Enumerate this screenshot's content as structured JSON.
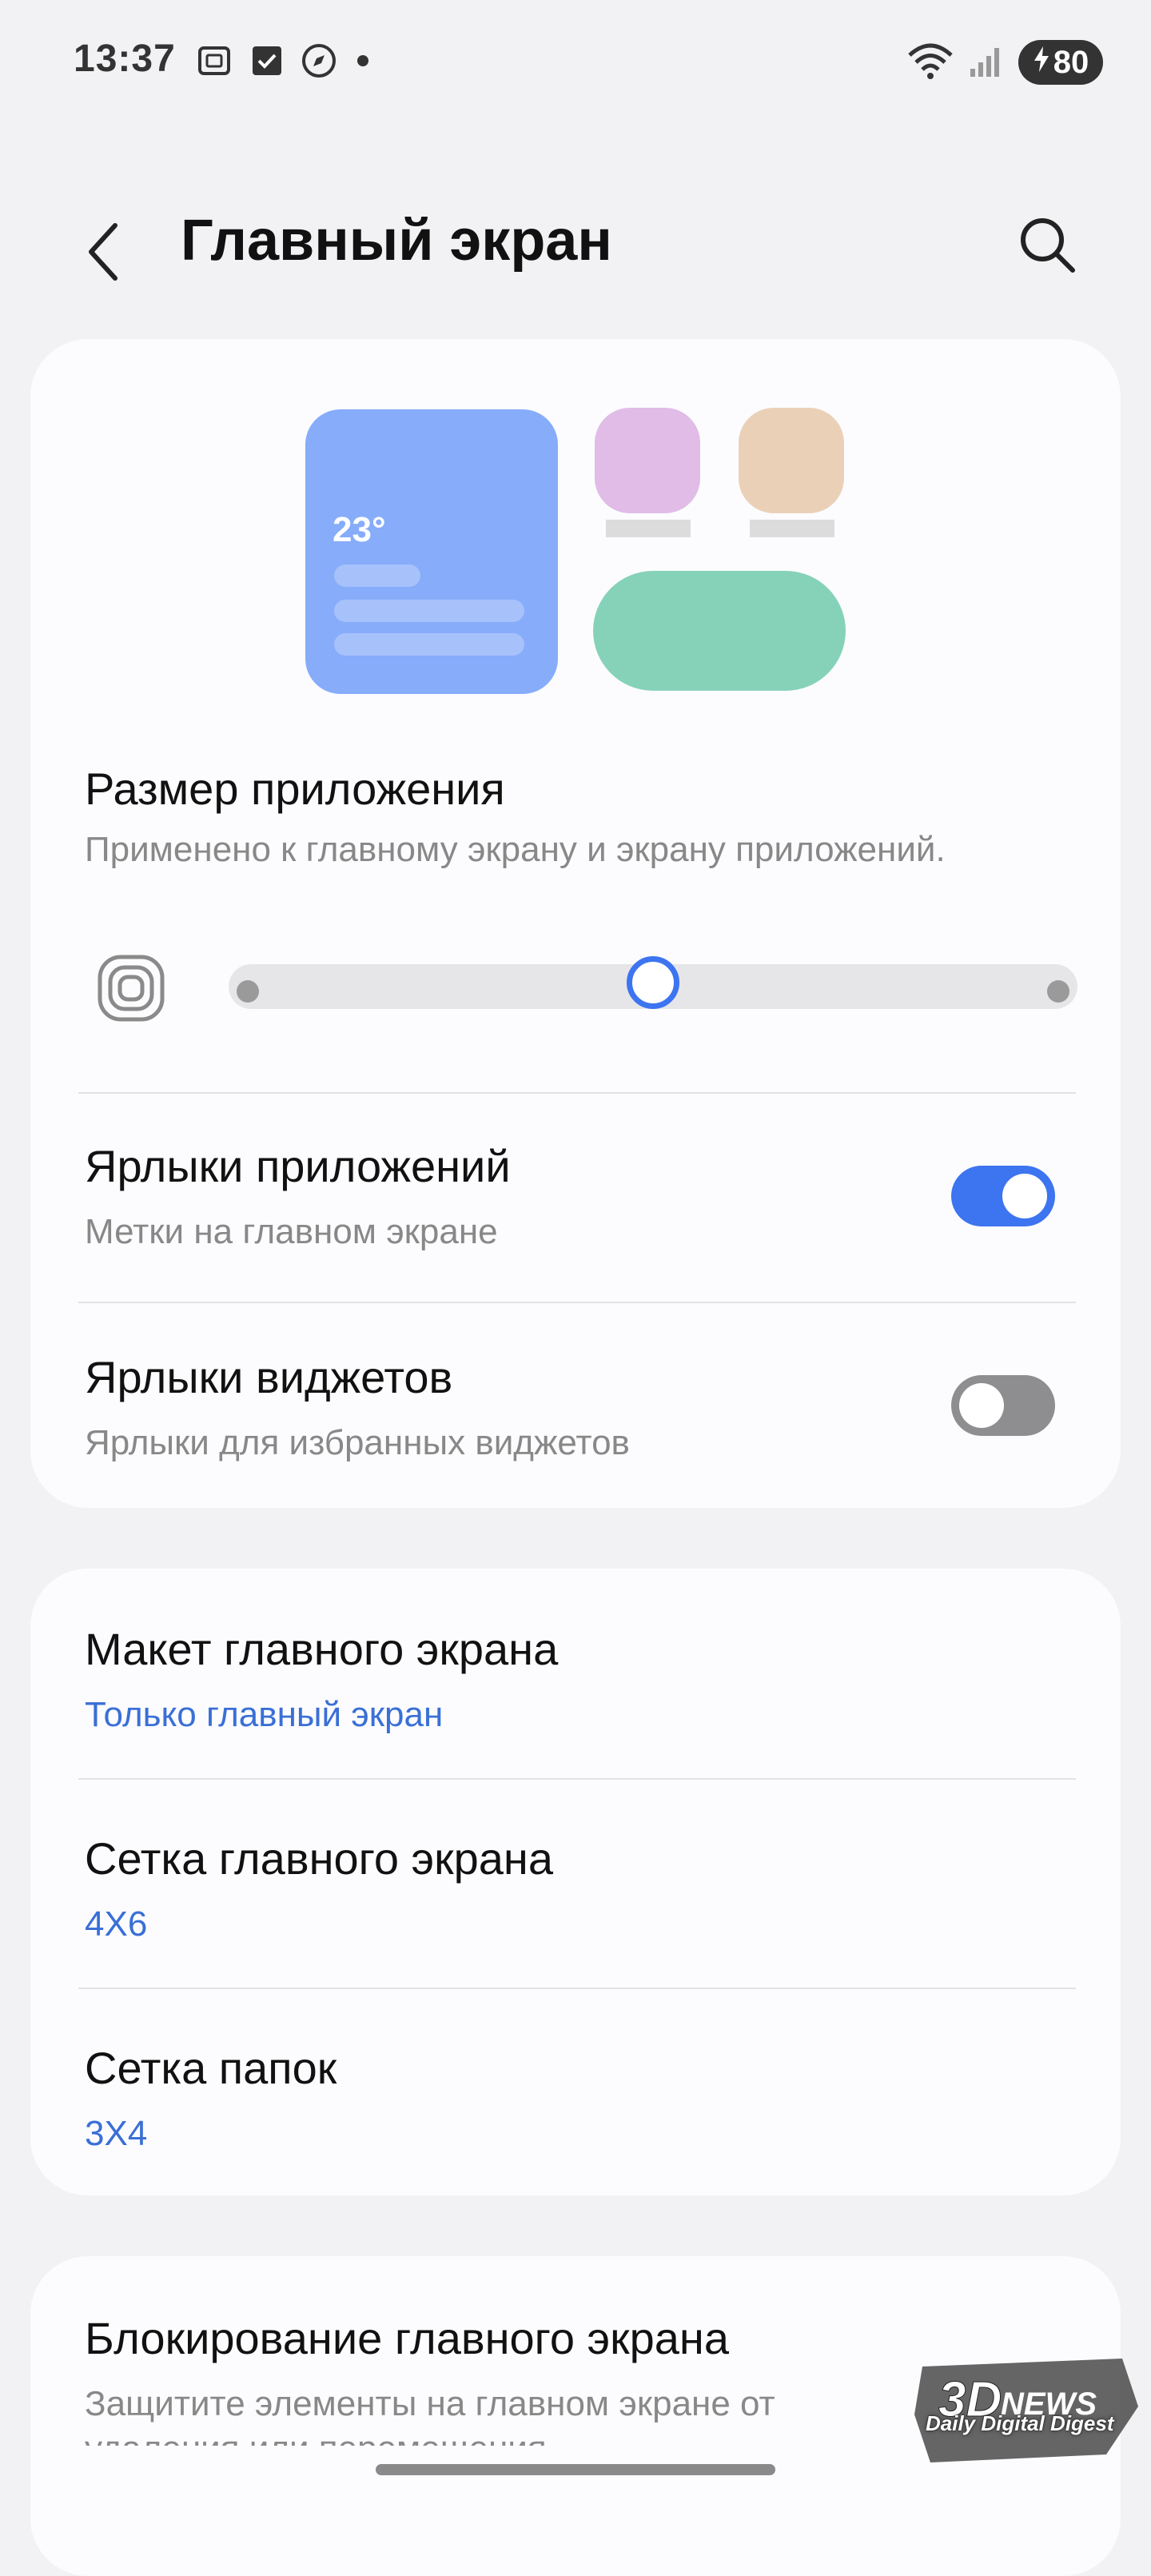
{
  "status_bar": {
    "time": "13:37",
    "icons": [
      "screenshot-icon",
      "checkbox-icon",
      "compass-icon",
      "dot-icon"
    ],
    "battery": "80"
  },
  "header": {
    "title": "Главный экран"
  },
  "preview": {
    "temperature": "23°"
  },
  "app_size": {
    "title": "Размер приложения",
    "subtitle": "Применено к главному экрану и экрану приложений.",
    "slider_position": 0.5
  },
  "app_labels": {
    "title": "Ярлыки приложений",
    "subtitle": "Метки на главном экране",
    "enabled": true
  },
  "widget_labels": {
    "title": "Ярлыки виджетов",
    "subtitle": "Ярлыки для избранных виджетов",
    "enabled": false
  },
  "layout": {
    "title": "Макет главного экрана",
    "value": "Только главный экран"
  },
  "grid": {
    "title": "Сетка главного экрана",
    "value": "4X6"
  },
  "folder_grid": {
    "title": "Сетка папок",
    "value": "3X4"
  },
  "lock": {
    "title": "Блокирование главного экрана",
    "subtitle_line1": "Защитите элементы на главном экране от",
    "subtitle_line2": "удаления или перемещения."
  },
  "watermark": {
    "brand": "3DNEWS",
    "tagline": "Daily Digital Digest"
  },
  "colors": {
    "accent": "#3d74f0",
    "link": "#3a6fd6",
    "background": "#f2f2f4",
    "card": "#fcfcfe"
  }
}
